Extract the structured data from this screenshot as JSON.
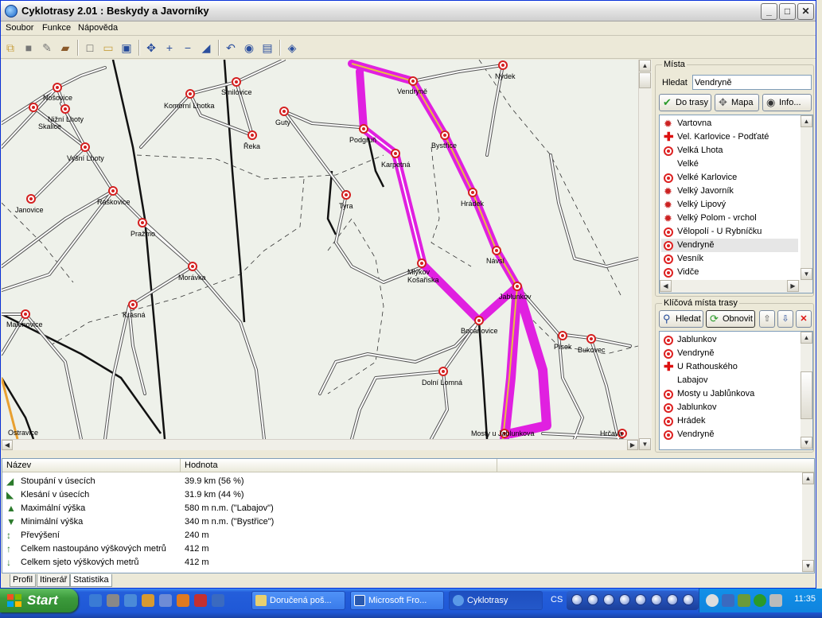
{
  "window": {
    "title": "Cyklotrasy 2.01 : Beskydy a Javorníky",
    "controls": {
      "minimize": "_",
      "maximize": "□",
      "close": "✕"
    }
  },
  "menu": [
    "Soubor",
    "Funkce",
    "Nápověda"
  ],
  "map": {
    "places": [
      {
        "name": "Nošovice"
      },
      {
        "name": "Nižní Lhoty"
      },
      {
        "name": "Skalice"
      },
      {
        "name": "Vyšní Lhoty"
      },
      {
        "name": "Komorní Lhotka"
      },
      {
        "name": "Smilovice"
      },
      {
        "name": "Guty"
      },
      {
        "name": "Řeka"
      },
      {
        "name": "Vendryně"
      },
      {
        "name": "Nýdek"
      },
      {
        "name": "Podgruň"
      },
      {
        "name": "Bystřice"
      },
      {
        "name": "Karpetná"
      },
      {
        "name": "Hrádek"
      },
      {
        "name": "Tyra"
      },
      {
        "name": "Janovice"
      },
      {
        "name": "Raškovice"
      },
      {
        "name": "Pražmo"
      },
      {
        "name": "Morávka"
      },
      {
        "name": "Krásná"
      },
      {
        "name": "Mlýkov Košařiska"
      },
      {
        "name": "Návsí"
      },
      {
        "name": "Jablunkov"
      },
      {
        "name": "Malenovice"
      },
      {
        "name": "Bocanovice"
      },
      {
        "name": "Písek"
      },
      {
        "name": "Bukovec"
      },
      {
        "name": "Dolní Lomná"
      },
      {
        "name": "Ostravice"
      },
      {
        "name": "Mosty u Jablunkova"
      },
      {
        "name": "Hrčava"
      }
    ]
  },
  "places_panel": {
    "group_label": "Místa",
    "search_label": "Hledat",
    "search_value": "Vendryně",
    "buttons": {
      "to_route": "Do trasy",
      "map": "Mapa",
      "info": "Info..."
    },
    "items": [
      {
        "label": "Vartovna",
        "icon": "gear-icon"
      },
      {
        "label": "Vel. Karlovice - Podťaté",
        "icon": "cross-icon"
      },
      {
        "label": "Velká Lhota",
        "icon": "circle-icon"
      },
      {
        "label": "Velké",
        "icon": ""
      },
      {
        "label": "Velké Karlovice",
        "icon": "circle-icon"
      },
      {
        "label": "Velký Javorník",
        "icon": "gear-icon"
      },
      {
        "label": "Velký Lipový",
        "icon": "gear-icon"
      },
      {
        "label": "Velký Polom - vrchol",
        "icon": "gear-icon"
      },
      {
        "label": "Vělopolí - U Rybníčku",
        "icon": "circle-icon"
      },
      {
        "label": "Vendryně",
        "icon": "circle-icon",
        "selected": true
      },
      {
        "label": "Vesník",
        "icon": "circle-icon"
      },
      {
        "label": "Vidče",
        "icon": "circle-icon"
      }
    ]
  },
  "route_panel": {
    "group_label": "Klíčová místa trasy",
    "buttons": {
      "search": "Hledat",
      "refresh": "Obnovit"
    },
    "items": [
      {
        "label": "Jablunkov",
        "icon": "circle-icon"
      },
      {
        "label": "Vendryně",
        "icon": "circle-icon"
      },
      {
        "label": "U Rathouského",
        "icon": "cross-icon"
      },
      {
        "label": "Labajov",
        "icon": ""
      },
      {
        "label": "Mosty u Jablůnkova",
        "icon": "circle-icon"
      },
      {
        "label": "Jablunkov",
        "icon": "circle-icon"
      },
      {
        "label": "Hrádek",
        "icon": "circle-icon"
      },
      {
        "label": "Vendryně",
        "icon": "circle-icon"
      }
    ]
  },
  "stats": {
    "columns": [
      "Název",
      "Hodnota"
    ],
    "rows": [
      {
        "name": "Stoupání v úsecích",
        "value": "39.9 km (56 %)"
      },
      {
        "name": "Klesání v úsecích",
        "value": "31.9 km (44 %)"
      },
      {
        "name": "Maximální výška",
        "value": "580 m n.m. (\"Labajov\")"
      },
      {
        "name": "Minimální výška",
        "value": "340 m n.m. (\"Bystřice\")"
      },
      {
        "name": "Převýšení",
        "value": "240 m"
      },
      {
        "name": "Celkem nastoupáno výškových metrů",
        "value": "412 m"
      },
      {
        "name": "Celkem sjeto výškových metrů",
        "value": "412 m"
      }
    ]
  },
  "tabs": [
    "Profil",
    "Itinerář",
    "Statistika"
  ],
  "taskbar": {
    "start": "Start",
    "tasks": [
      "Doručená poš...",
      "Microsoft Fro...",
      "Cyklotrasy"
    ],
    "lang": "CS",
    "clock": "11:35"
  },
  "colors": {
    "route": "#e020e0",
    "route_center": "#e8c040",
    "title_blue": "#0831d9"
  }
}
